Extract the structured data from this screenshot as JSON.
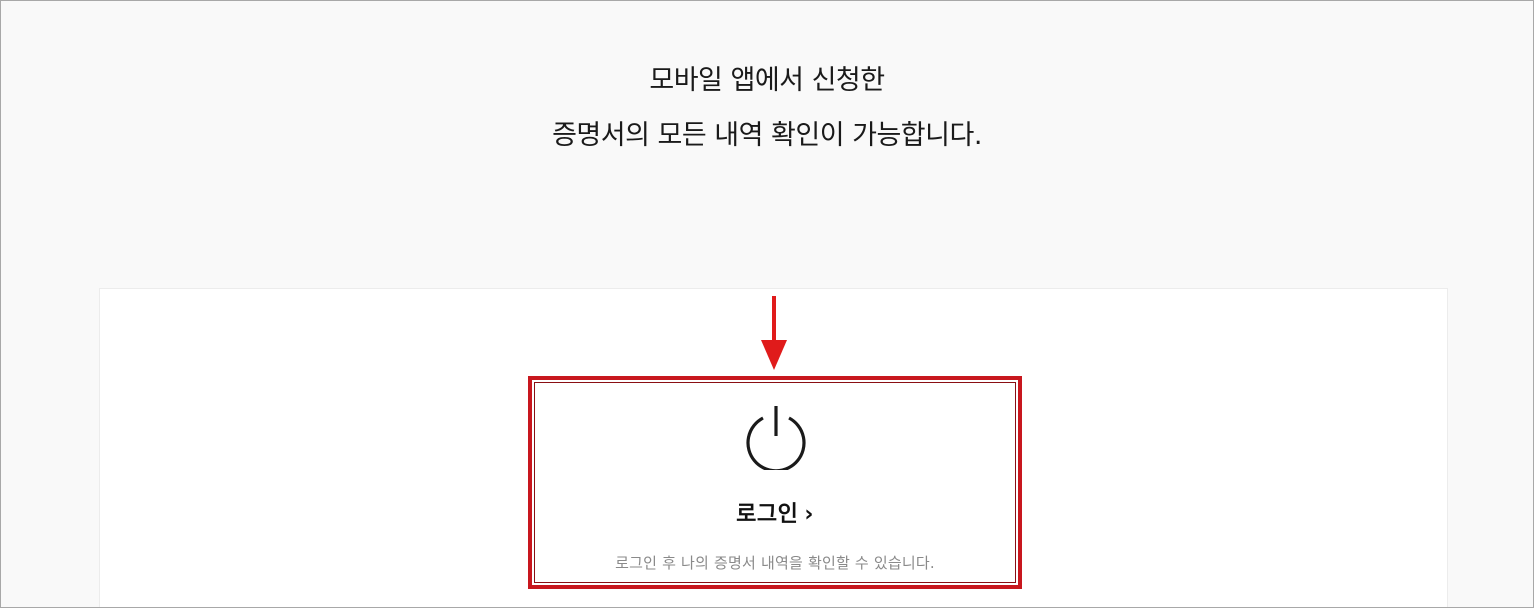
{
  "headline": {
    "line1": "모바일 앱에서 신청한",
    "line2": "증명서의 모든 내역 확인이 가능합니다."
  },
  "login_card": {
    "title": "로그인",
    "chevron": "›",
    "description": "로그인 후 나의 증명서 내역을 확인할 수 있습니다.",
    "icon": "power-icon"
  },
  "annotation": {
    "arrow_color": "#e01b1b",
    "box_color": "#c8171e"
  }
}
